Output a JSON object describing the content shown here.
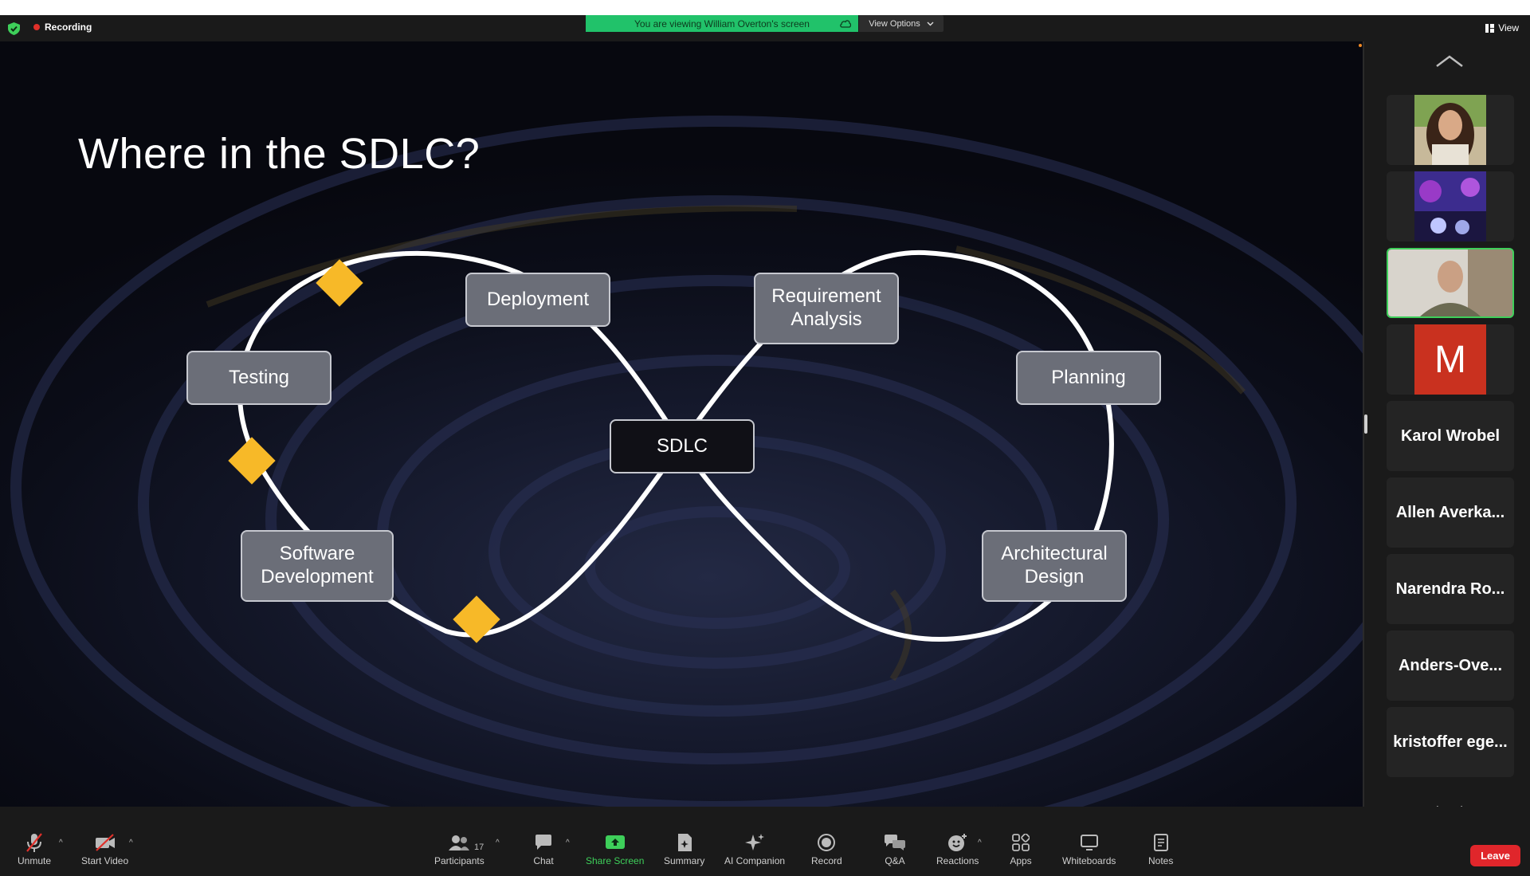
{
  "topbar": {
    "recording_label": "Recording",
    "banner_text": "You are viewing William Overton's screen",
    "view_options_label": "View Options",
    "view_label": "View"
  },
  "slide": {
    "title": "Where in the SDLC?",
    "center_label": "SDLC",
    "stages": {
      "deployment": "Deployment",
      "requirement_line1": "Requirement",
      "requirement_line2": "Analysis",
      "planning": "Planning",
      "testing": "Testing",
      "software_line1": "Software",
      "software_line2": "Development",
      "architectural_line1": "Architectural",
      "architectural_line2": "Design"
    },
    "marker_color": "#f7b928"
  },
  "gallery": {
    "m_initial": "M",
    "participants": [
      "Karol Wrobel",
      "Allen Averka...",
      "Narendra Ro...",
      "Anders-Ove...",
      "kristoffer ege..."
    ]
  },
  "toolbar": {
    "unmute": "Unmute",
    "start_video": "Start Video",
    "participants": "Participants",
    "participants_count": "17",
    "chat": "Chat",
    "share_screen": "Share Screen",
    "summary": "Summary",
    "ai_companion": "AI Companion",
    "record": "Record",
    "qa": "Q&A",
    "reactions": "Reactions",
    "apps": "Apps",
    "whiteboards": "Whiteboards",
    "notes": "Notes",
    "leave": "Leave"
  },
  "colors": {
    "share_green": "#3ecf5a",
    "banner_green": "#21c26a",
    "leave_red": "#e0262b"
  }
}
